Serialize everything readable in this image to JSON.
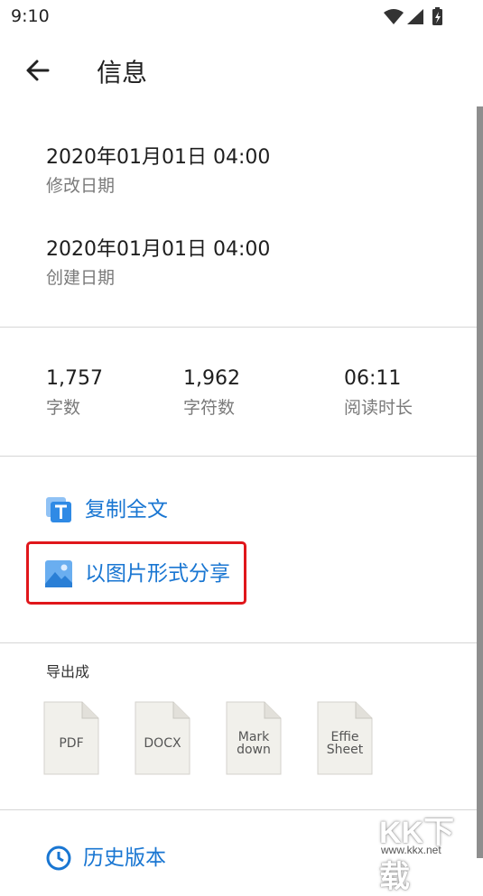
{
  "status_bar": {
    "time": "9:10"
  },
  "app_bar": {
    "title": "信息"
  },
  "dates": {
    "modified": {
      "value": "2020年01月01日 04:00",
      "label": "修改日期"
    },
    "created": {
      "value": "2020年01月01日 04:00",
      "label": "创建日期"
    }
  },
  "stats": [
    {
      "value": "1,757",
      "label": "字数"
    },
    {
      "value": "1,962",
      "label": "字符数"
    },
    {
      "value": "06:11",
      "label": "阅读时长"
    }
  ],
  "actions": {
    "copy_all": "复制全文",
    "share_image": "以图片形式分享"
  },
  "export": {
    "title": "导出成",
    "formats": [
      {
        "lines": [
          "PDF"
        ]
      },
      {
        "lines": [
          "DOCX"
        ]
      },
      {
        "lines": [
          "Mark",
          "down"
        ]
      },
      {
        "lines": [
          "Effie",
          "Sheet"
        ]
      }
    ]
  },
  "history": {
    "label": "历史版本"
  },
  "watermark": {
    "text": "KK下载",
    "url": "www.kkx.net"
  },
  "colors": {
    "accent": "#1976d2",
    "highlight": "#e0161b",
    "divider": "#d6d6d6"
  }
}
